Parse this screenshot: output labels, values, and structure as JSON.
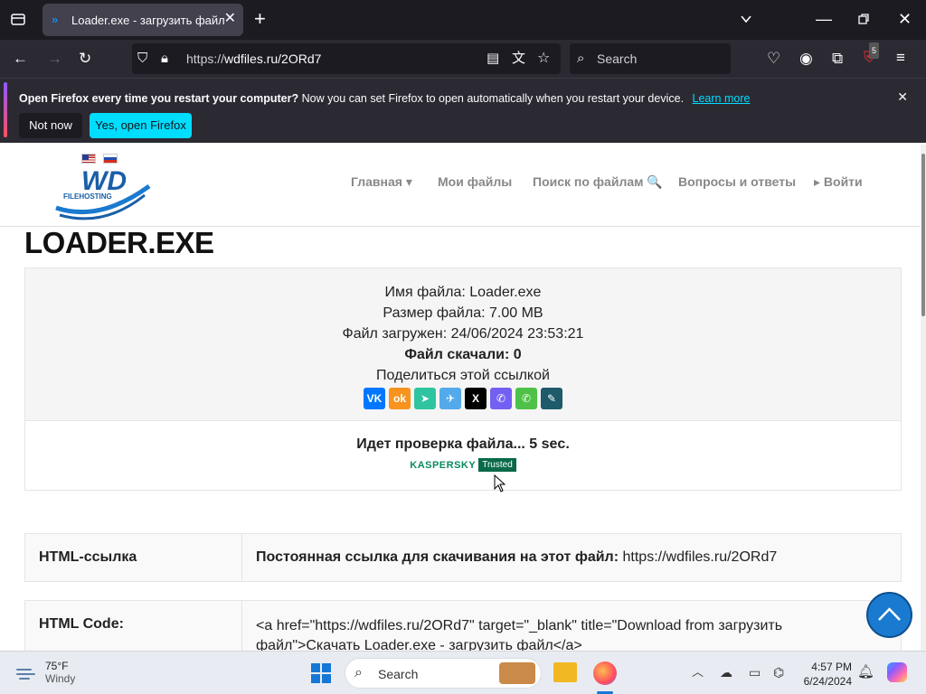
{
  "browser": {
    "tab_title": "Loader.exe - загрузить файл",
    "url_prefix": "https://",
    "url_host": "wdfiles.ru/2ORd7",
    "search_placeholder": "Search",
    "extension_badge": "5"
  },
  "notification": {
    "bold": "Open Firefox every time you restart your computer?",
    "text": "Now you can set Firefox to open automatically when you restart your device.",
    "link": "Learn more",
    "btn_no": "Not now",
    "btn_yes": "Yes, open Firefox"
  },
  "site": {
    "logo_text": "WD",
    "logo_sub": "FILEHOSTING",
    "menu": [
      "Главная ▾",
      "Мои файлы",
      "Поиск по файлам 🔍",
      "Вопросы и ответы",
      "▸ Войти"
    ]
  },
  "file": {
    "title": "LOADER.EXE",
    "name_line": "Имя файла: Loader.exe",
    "size_line": "Размер файла: 7.00 MB",
    "uploaded_line": "Файл загружен: 24/06/2024 23:53:21",
    "downloads_line": "Файл скачали: 0",
    "share_line": "Поделиться этой ссылкой",
    "check_line": "Идет проверка файла... 5 sec.",
    "kaspersky": "KASPERSKY",
    "trusted": "Trusted"
  },
  "rows": {
    "html_link_label": "HTML-ссылка",
    "html_link_bold": "Постоянная ссылка для скачивания на этот файл:",
    "html_link_value": "https://wdfiles.ru/2ORd7",
    "html_code_label": "HTML Code:",
    "html_code_value": "<a href=\"https://wdfiles.ru/2ORd7\" target=\"_blank\" title=\"Download from загрузить файл\">Скачать Loader.exe - загрузить файл</a>"
  },
  "taskbar": {
    "temp": "75°F",
    "weather": "Windy",
    "search": "Search",
    "time": "4:57 PM",
    "date": "6/24/2024"
  },
  "colors": {
    "firefox_accent": "#00ddff",
    "site_blue": "#1a7ad0"
  }
}
